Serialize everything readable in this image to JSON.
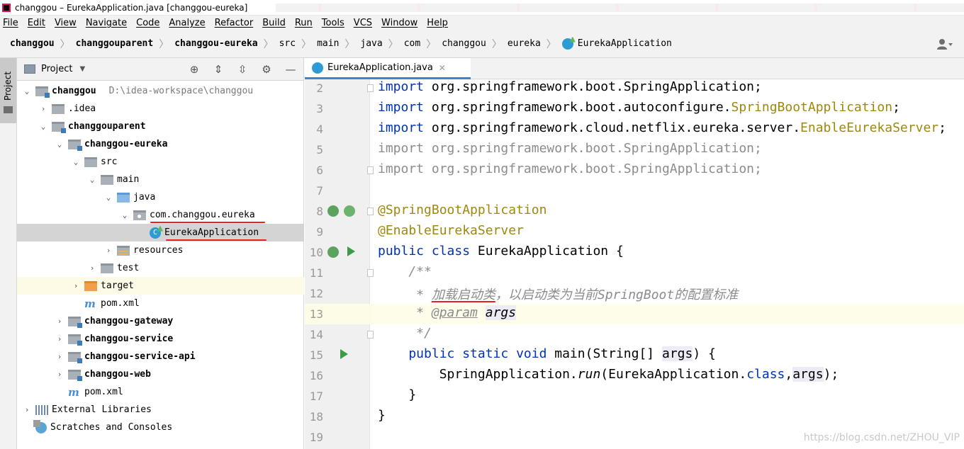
{
  "window": {
    "title": "changgou – EurekaApplication.java [changgou-eureka]"
  },
  "menu": [
    "File",
    "Edit",
    "View",
    "Navigate",
    "Code",
    "Analyze",
    "Refactor",
    "Build",
    "Run",
    "Tools",
    "VCS",
    "Window",
    "Help"
  ],
  "breadcrumb": [
    "changgou",
    "changgouparent",
    "changgou-eureka",
    "src",
    "main",
    "java",
    "com",
    "changgou",
    "eureka",
    "EurekaApplication"
  ],
  "project_panel": {
    "title": "Project",
    "side_tab": "Project",
    "tree": [
      {
        "label": "changgou",
        "hint": "D:\\idea-workspace\\changgou",
        "bold": true
      },
      {
        "label": ".idea"
      },
      {
        "label": "changgouparent",
        "bold": true
      },
      {
        "label": "changgou-eureka",
        "bold": true
      },
      {
        "label": "src"
      },
      {
        "label": "main"
      },
      {
        "label": "java"
      },
      {
        "label": "com.changgou.eureka"
      },
      {
        "label": "EurekaApplication"
      },
      {
        "label": "resources"
      },
      {
        "label": "test"
      },
      {
        "label": "target"
      },
      {
        "label": "pom.xml"
      },
      {
        "label": "changgou-gateway",
        "bold": true
      },
      {
        "label": "changgou-service",
        "bold": true
      },
      {
        "label": "changgou-service-api",
        "bold": true
      },
      {
        "label": "changgou-web",
        "bold": true
      },
      {
        "label": "pom.xml"
      },
      {
        "label": "External Libraries"
      },
      {
        "label": "Scratches and Consoles"
      }
    ]
  },
  "editor": {
    "tab_label": "EurekaApplication.java",
    "line_numbers": [
      "2",
      "3",
      "4",
      "5",
      "6",
      "7",
      "8",
      "9",
      "10",
      "11",
      "12",
      "13",
      "14",
      "15",
      "16",
      "17",
      "18",
      "19"
    ],
    "code": {
      "l2_kw": "import",
      "l2_rest": " org.springframework.boot.SpringApplication;",
      "l3_kw": "import",
      "l3_rest": " org.springframework.boot.autoconfigure.",
      "l3_ann": "SpringBootApplication",
      "l3_end": ";",
      "l4_kw": "import",
      "l4_rest": " org.springframework.cloud.netflix.eureka.server.",
      "l4_ann": "EnableEurekaServer",
      "l4_end": ";",
      "l5": "import org.springframework.boot.SpringApplication;",
      "l6": "import org.springframework.boot.SpringApplication;",
      "l8": "@SpringBootApplication",
      "l9": "@EnableEurekaServer",
      "l10_kw": "public class",
      "l10_rest": " EurekaApplication {",
      "l11": "    /**",
      "l12_star": "     * ",
      "l12_red": "加载启动类",
      "l12_rest": "，以启动类为当前SpringBoot的配置标准",
      "l13_star": "     * ",
      "l13_tag": "@param",
      "l13_sp": " ",
      "l13_arg": "args",
      "l14": "     */",
      "l15_kw": "    public static void",
      "l15_a": " main(String[] ",
      "l15_arg": "args",
      "l15_b": ") {",
      "l16_a": "        SpringApplication.",
      "l16_run": "run",
      "l16_b": "(EurekaApplication.",
      "l16_kw": "class",
      "l16_c": ",",
      "l16_arg": "args",
      "l16_d": ");",
      "l17": "    }",
      "l18": "}"
    }
  },
  "watermark": "https://blog.csdn.net/ZHOU_VIP"
}
